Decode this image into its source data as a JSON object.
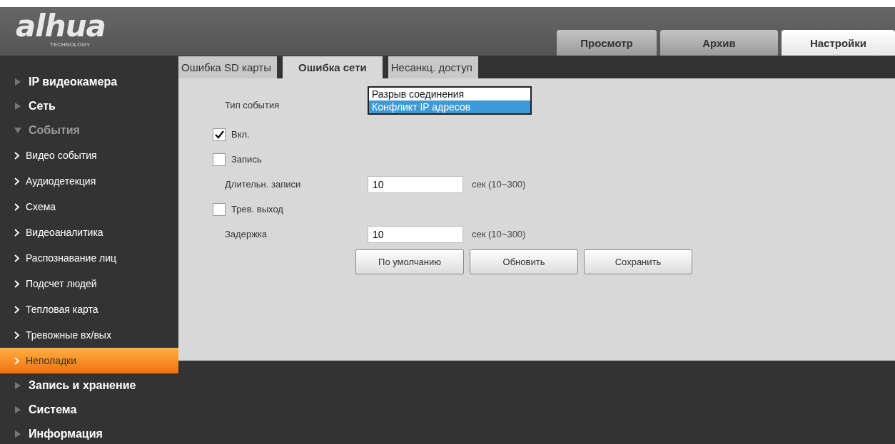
{
  "header": {
    "logo": {
      "brand": "alhua",
      "tagline": "TECHNOLOGY"
    },
    "tabs": [
      {
        "label": "Просмотр",
        "selected": false
      },
      {
        "label": "Архив",
        "selected": false
      },
      {
        "label": "Настройки",
        "selected": true
      }
    ]
  },
  "sidebar": {
    "items": [
      {
        "label": "IP видеокамера",
        "expanded": false
      },
      {
        "label": "Сеть",
        "expanded": false
      },
      {
        "label": "События",
        "expanded": true,
        "children": [
          {
            "label": "Видео события",
            "selected": false
          },
          {
            "label": "Аудиодетекция",
            "selected": false
          },
          {
            "label": "Схема",
            "selected": false
          },
          {
            "label": "Видеоаналитика",
            "selected": false
          },
          {
            "label": "Распознавание лиц",
            "selected": false
          },
          {
            "label": "Подсчет людей",
            "selected": false
          },
          {
            "label": "Тепловая карта",
            "selected": false
          },
          {
            "label": "Тревожные вх/вых",
            "selected": false
          },
          {
            "label": "Неполадки",
            "selected": true
          }
        ]
      },
      {
        "label": "Запись и хранение",
        "expanded": false
      },
      {
        "label": "Система",
        "expanded": false
      },
      {
        "label": "Информация",
        "expanded": false
      }
    ]
  },
  "subtabs": [
    {
      "label": "Ошибка SD карты",
      "selected": false
    },
    {
      "label": "Ошибка сети",
      "selected": true
    },
    {
      "label": "Несанкц. доступ",
      "selected": false
    }
  ],
  "form": {
    "rows": [
      {
        "kind": "select",
        "label": "Тип события",
        "options": [
          {
            "label": "Разрыв соединения",
            "selected": false
          },
          {
            "label": "Конфликт IP адресов",
            "selected": true
          }
        ]
      },
      {
        "kind": "checkbox",
        "label": "Вкл.",
        "checked": true
      },
      {
        "kind": "checkbox",
        "label": "Запись",
        "checked": false
      },
      {
        "kind": "number",
        "label": "Длительн. записи",
        "value": "10",
        "hint": "сек (10~300)"
      },
      {
        "kind": "checkbox",
        "label": "Трев. выход",
        "checked": false
      },
      {
        "kind": "number",
        "label": "Задержка",
        "value": "10",
        "hint": "сек (10~300)"
      }
    ],
    "buttons": [
      "По умолчанию",
      "Обновить",
      "Сохранить"
    ]
  }
}
